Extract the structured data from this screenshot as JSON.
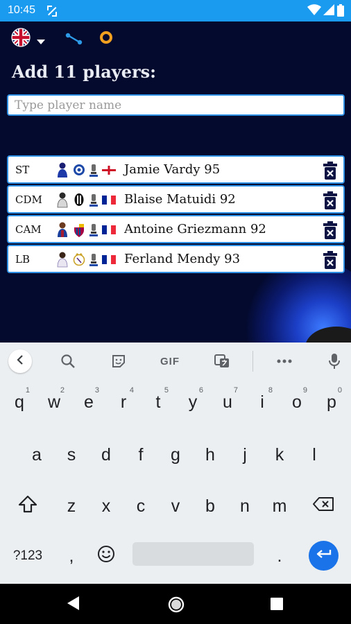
{
  "status_bar": {
    "time": "10:45"
  },
  "app": {
    "title": "Add 11 players:",
    "name_input": {
      "value": "",
      "placeholder": "Type player name"
    },
    "players": [
      {
        "position": "ST",
        "name": "Jamie Vardy 95",
        "nation_flag": "england-flag",
        "club_badge": "leicester-badge"
      },
      {
        "position": "CDM",
        "name": "Blaise Matuidi 92",
        "nation_flag": "france-flag",
        "club_badge": "juventus-badge"
      },
      {
        "position": "CAM",
        "name": "Antoine Griezmann 92",
        "nation_flag": "france-flag",
        "club_badge": "barcelona-badge"
      },
      {
        "position": "LB",
        "name": "Ferland Mendy 93",
        "nation_flag": "france-flag",
        "club_badge": "real-madrid-badge"
      }
    ],
    "colors": {
      "background": "#040a2e",
      "row_border": "#2e90e4",
      "status_bar": "#1a9bf0"
    }
  },
  "keyboard": {
    "row1": [
      {
        "key": "q",
        "hint": "1"
      },
      {
        "key": "w",
        "hint": "2"
      },
      {
        "key": "e",
        "hint": "3"
      },
      {
        "key": "r",
        "hint": "4"
      },
      {
        "key": "t",
        "hint": "5"
      },
      {
        "key": "y",
        "hint": "6"
      },
      {
        "key": "u",
        "hint": "7"
      },
      {
        "key": "i",
        "hint": "8"
      },
      {
        "key": "o",
        "hint": "9"
      },
      {
        "key": "p",
        "hint": "0"
      }
    ],
    "row2": [
      "a",
      "s",
      "d",
      "f",
      "g",
      "h",
      "j",
      "k",
      "l"
    ],
    "row3": [
      "z",
      "x",
      "c",
      "v",
      "b",
      "n",
      "m"
    ],
    "symbols_label": "?123",
    "comma": ",",
    "period": ".",
    "gif_label": "GIF"
  }
}
